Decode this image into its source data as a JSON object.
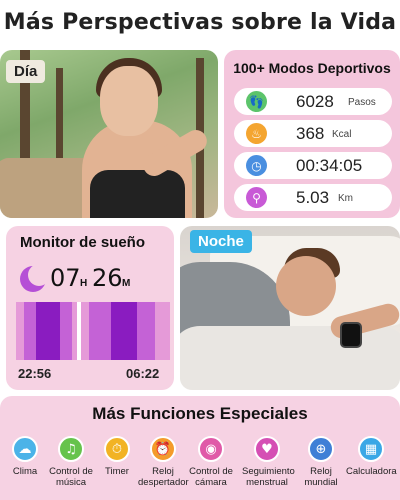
{
  "title": "Más Perspectivas sobre la Vida",
  "day_tag": "Día",
  "night_tag": "Noche",
  "sports": {
    "title": "100+ Modos Deportivos",
    "metrics": [
      {
        "icon": "footprints-icon",
        "value": "6028",
        "unit": "Pasos",
        "color": "#5cc46b"
      },
      {
        "icon": "flame-icon",
        "value": "368",
        "unit": "Kcal",
        "color": "#f4a530"
      },
      {
        "icon": "clock-icon",
        "value": "00:34:05",
        "unit": "",
        "color": "#4a8fe0"
      },
      {
        "icon": "location-pin-icon",
        "value": "5.03",
        "unit": "Km",
        "color": "#c85ad6"
      }
    ]
  },
  "sleep": {
    "title": "Monitor de sueño",
    "hours": "07",
    "hours_unit": "H",
    "minutes": "26",
    "minutes_unit": "M",
    "start": "22:56",
    "end": "06:22"
  },
  "functions": {
    "title": "Más Funciones Especiales",
    "items": [
      {
        "label": "Clima",
        "icon": "weather-icon",
        "color": "#4bb3e8"
      },
      {
        "label": "Control de\nmúsica",
        "icon": "music-icon",
        "color": "#66c34c"
      },
      {
        "label": "Timer",
        "icon": "timer-icon",
        "color": "#f2b324"
      },
      {
        "label": "Reloj\ndespertador",
        "icon": "alarm-clock-icon",
        "color": "#f49b2a"
      },
      {
        "label": "Control de\ncámara",
        "icon": "camera-icon",
        "color": "#e05aa8"
      },
      {
        "label": "Seguimiento\nmenstrual",
        "icon": "heart-icon",
        "color": "#d54fb4"
      },
      {
        "label": "Reloj\nmundial",
        "icon": "globe-icon",
        "color": "#3f7fd6"
      },
      {
        "label": "Calculadora",
        "icon": "calculator-icon",
        "color": "#3aa7e6"
      }
    ]
  }
}
